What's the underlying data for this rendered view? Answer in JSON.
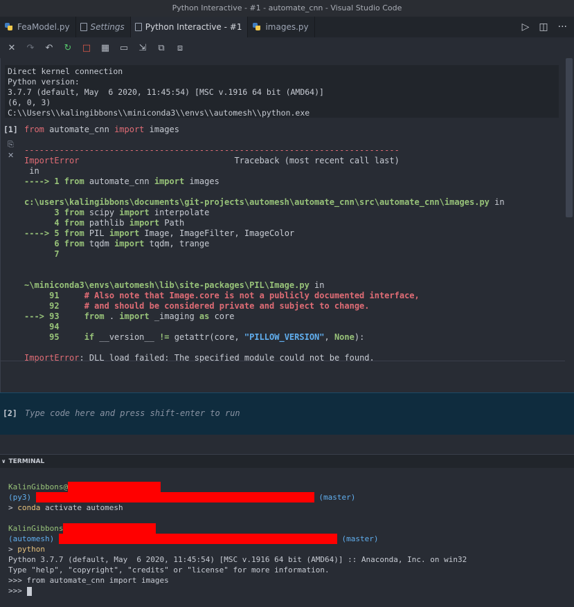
{
  "window": {
    "title": "Python Interactive - #1 - automate_cnn - Visual Studio Code"
  },
  "tabs": [
    {
      "label": "FeaModel.py",
      "icon": "python-icon"
    },
    {
      "label": "Settings",
      "icon": "document-icon"
    },
    {
      "label": "Python Interactive - #1",
      "icon": "none"
    },
    {
      "label": "images.py",
      "icon": "python-icon"
    }
  ],
  "sysinfo": {
    "line1": "Direct kernel connection",
    "line2": "Python version:",
    "line3": "3.7.7 (default, May  6 2020, 11:45:54) [MSC v.1916 64 bit (AMD64)]",
    "line4": "(6, 0, 3)",
    "line5": "C:\\\\Users\\\\kalingibbons\\\\miniconda3\\\\envs\\\\automesh\\\\python.exe"
  },
  "cell1": {
    "number": "[1]",
    "code_from": "from",
    "code_mod": " automate_cnn ",
    "code_import": "import",
    "code_name": " images"
  },
  "output": {
    "dashes": "---------------------------------------------------------------------------",
    "err_name": "ImportError",
    "traceback": "                               Traceback (most recent call last)",
    "in_label": " in",
    "arrow1": "----> 1 ",
    "line1_from": "from",
    "line1_mod": " automate_cnn ",
    "line1_import": "import",
    "line1_name": " images",
    "path1": "c:\\users\\kalingibbons\\documents\\git-projects\\automesh\\automate_cnn\\src\\automate_cnn\\images.py",
    "path1_in": " in",
    "l3_num": "      3 ",
    "l3_from": "from",
    "l3_mod": " scipy ",
    "l3_import": "import",
    "l3_name": " interpolate",
    "l4_num": "      4 ",
    "l4_from": "from",
    "l4_mod": " pathlib ",
    "l4_import": "import",
    "l4_name": " Path",
    "l5_num": "----> 5 ",
    "l5_from": "from",
    "l5_mod": " PIL ",
    "l5_import": "import",
    "l5_name": " Image, ImageFilter, ImageColor",
    "l6_num": "      6 ",
    "l6_from": "from",
    "l6_mod": " tqdm ",
    "l6_import": "import",
    "l6_name": " tqdm, trange",
    "l7_num": "      7",
    "path2": "~\\miniconda3\\envs\\automesh\\lib\\site-packages\\PIL\\Image.py",
    "path2_in": " in",
    "l91_num": "     91     ",
    "l91_comment": "# Also note that Image.core is not a publicly documented interface,",
    "l92_num": "     92     ",
    "l92_comment": "# and should be considered private and subject to change.",
    "l93_num": "---> 93     ",
    "l93_from": "from",
    "l93_mod": " . ",
    "l93_import": "import",
    "l93_name": " _imaging ",
    "l93_as": "as",
    "l93_core": " core",
    "l94_num": "     94",
    "l95_num": "     95     ",
    "l95_if": "if",
    "l95_mid": " __version__ ",
    "l95_ne": "!=",
    "l95_getattr": " getattr(core, ",
    "l95_str": "\"PILLOW_VERSION\"",
    "l95_comma": ", ",
    "l95_none": "None",
    "l95_end": "):",
    "final_err": "ImportError",
    "final_msg": ": DLL load failed: The specified module could not be found."
  },
  "input_cell": {
    "number": "[2]",
    "placeholder": "Type code here and press shift-enter to run"
  },
  "terminal": {
    "header": "TERMINAL",
    "user1": "KalinGibbons@",
    "env1": "(py3)",
    "branch1": "(master)",
    "cmd1_prompt": "> ",
    "cmd1_a": "conda",
    "cmd1_b": " activate automesh",
    "user2": "KalinGibbons",
    "env2": "(automesh)",
    "branch2": "(master)",
    "cmd2_prompt": "> ",
    "cmd2": "python",
    "py_line1": "Python 3.7.7 (default, May  6 2020, 11:45:54) [MSC v.1916 64 bit (AMD64)] :: Anaconda, Inc. on win32",
    "py_line2": "Type \"help\", \"copyright\", \"credits\" or \"license\" for more information.",
    "py_line3": ">>> from automate_cnn import images",
    "py_line4": ">>> "
  }
}
